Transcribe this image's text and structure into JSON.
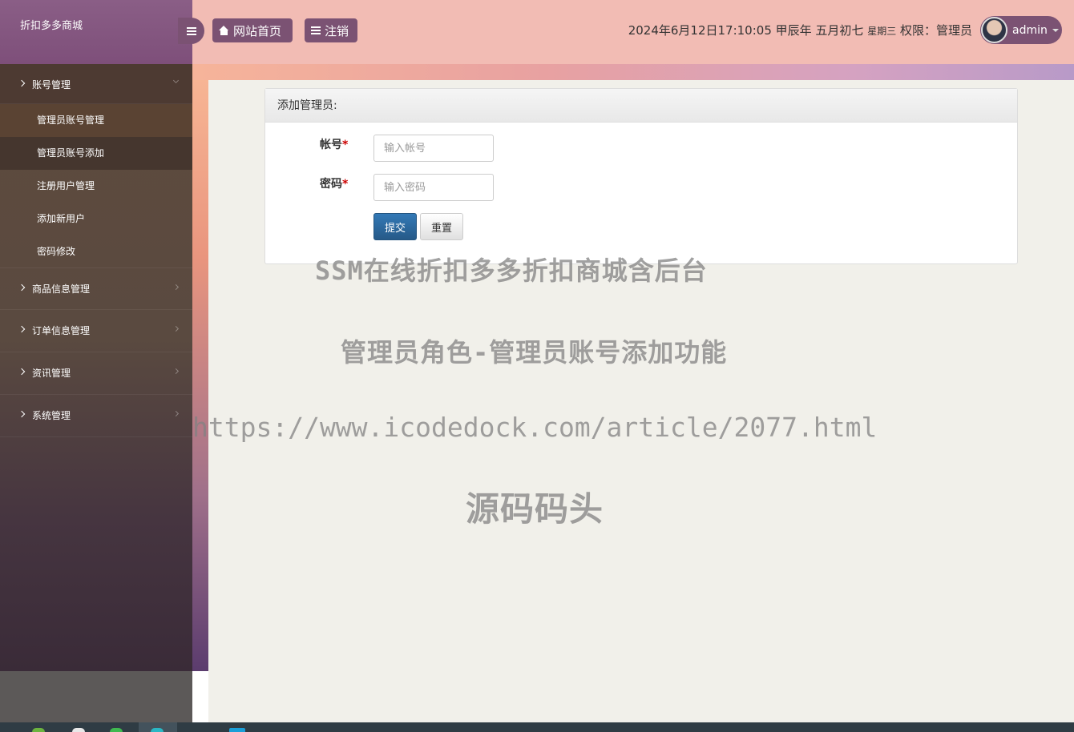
{
  "brand": {
    "title": "折扣多多商城"
  },
  "header": {
    "home_label": "网站首页",
    "logout_label": "注销",
    "datetime": "2024年6月12日17:10:05 甲辰年 五月初七",
    "weekday": "星期三",
    "role_text": "权限：管理员",
    "username": "admin"
  },
  "sidebar": {
    "account_menu": "账号管理",
    "sub_items": [
      "管理员账号管理",
      "管理员账号添加",
      "注册用户管理",
      "添加新用户",
      "密码修改"
    ],
    "goods_menu": "商品信息管理",
    "order_menu": "订单信息管理",
    "news_menu": "资讯管理",
    "system_menu": "系统管理"
  },
  "form": {
    "title": "添加管理员:",
    "account_label": "帐号",
    "account_placeholder": "输入帐号",
    "password_label": "密码",
    "password_placeholder": "输入密码",
    "required_mark": "*",
    "submit_label": "提交",
    "reset_label": "重置"
  },
  "watermark": {
    "line1": "SSM在线折扣多多折扣商城含后台",
    "line2": "管理员角色-管理员账号添加功能",
    "line3": "https://www.icodedock.com/article/2077.html",
    "line4": "源码码头"
  },
  "colors": {
    "brand": "#7b5273",
    "topbar": "#f2bcb4",
    "sidebar": "#5e4b3d",
    "primary": "#337ab7",
    "required": "#cc0000"
  }
}
